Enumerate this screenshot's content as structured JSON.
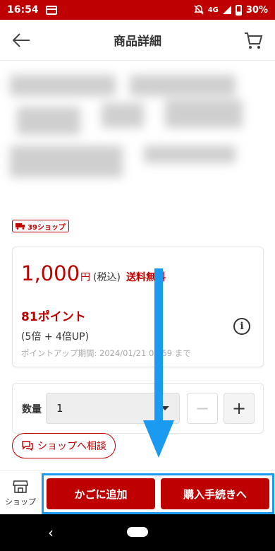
{
  "status_bar": {
    "time": "16:54",
    "network": "4G",
    "battery": "30%"
  },
  "header": {
    "title": "商品詳細"
  },
  "shop_badge": {
    "label": "39ショップ"
  },
  "price_card": {
    "price": "1,000",
    "currency": "円",
    "tax": "(税込)",
    "shipping": "送料無料",
    "points": "81ポイント",
    "points_detail": "(5倍 + 4倍UP)",
    "points_period": "ポイントアップ期間: 2024/01/21 01:59 まで"
  },
  "quantity": {
    "label": "数量",
    "value": "1",
    "minus": "−",
    "plus": "+"
  },
  "consult": {
    "label": "ショップへ相談"
  },
  "bottom_bar": {
    "shop_label": "ショップ",
    "add_to_cart": "かごに追加",
    "checkout": "購入手続きへ"
  },
  "colors": {
    "brand": "#bf0000",
    "highlight": "#1a9af0"
  }
}
